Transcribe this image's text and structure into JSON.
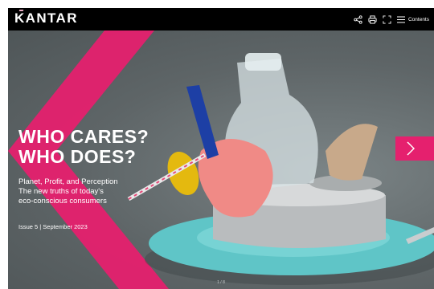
{
  "header": {
    "logo_text": "KANTAR",
    "logo_accent_color": "#f0b1c9",
    "tools": [
      {
        "icon": "share-icon"
      },
      {
        "icon": "print-icon"
      },
      {
        "icon": "fullscreen-icon"
      }
    ],
    "contents_label": "Contents",
    "contents_icon": "menu-icon"
  },
  "hero": {
    "title_line1": "WHO CARES?",
    "title_line2": "WHO DOES?",
    "subtitle_line1": "Planet, Profit, and Perception",
    "subtitle_line2": "The new truths of today's",
    "subtitle_line3": "eco-conscious consumers",
    "issue": "Issue 5 | September 2023"
  },
  "navigation": {
    "next_icon": "chevron-right-icon",
    "page_indicator": "1 / 8"
  },
  "colors": {
    "brand_pink": "#e5206e",
    "background": "#5f6668",
    "plate": "#5fc5c7"
  }
}
